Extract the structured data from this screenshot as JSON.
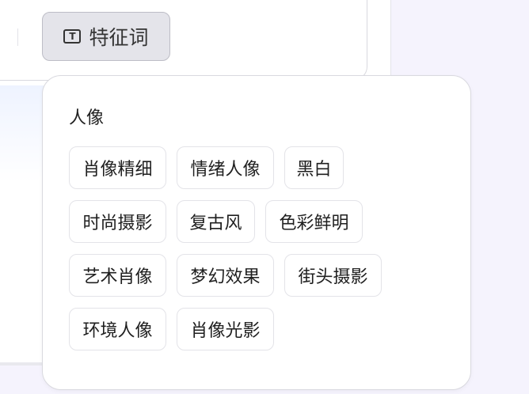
{
  "toolbar": {
    "feature_words_label": "特征词",
    "feature_words_icon": "text-box-icon"
  },
  "popover": {
    "category": "人像",
    "tags": [
      "肖像精细",
      "情绪人像",
      "黑白",
      "时尚摄影",
      "复古风",
      "色彩鲜明",
      "艺术肖像",
      "梦幻效果",
      "街头摄影",
      "环境人像",
      "肖像光影"
    ]
  }
}
